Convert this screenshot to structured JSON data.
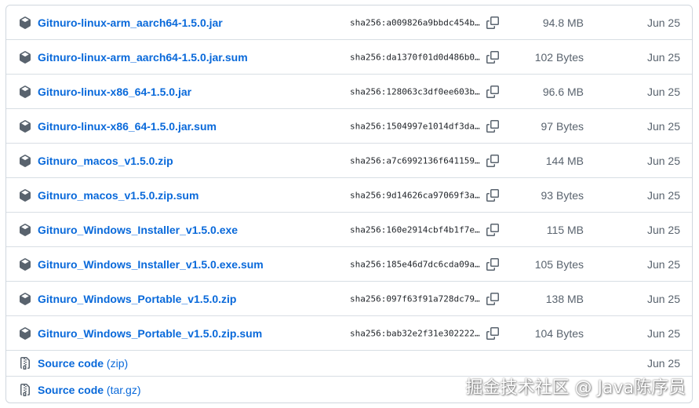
{
  "assets": [
    {
      "name": "Gitnuro-linux-arm_aarch64-1.5.0.jar",
      "sha": "sha256:a009826a9bbdc454b…",
      "size": "94.8 MB",
      "date": "Jun 25",
      "icon": "package-icon"
    },
    {
      "name": "Gitnuro-linux-arm_aarch64-1.5.0.jar.sum",
      "sha": "sha256:da1370f01d0d486b0…",
      "size": "102 Bytes",
      "date": "Jun 25",
      "icon": "package-icon"
    },
    {
      "name": "Gitnuro-linux-x86_64-1.5.0.jar",
      "sha": "sha256:128063c3df0ee603b…",
      "size": "96.6 MB",
      "date": "Jun 25",
      "icon": "package-icon"
    },
    {
      "name": "Gitnuro-linux-x86_64-1.5.0.jar.sum",
      "sha": "sha256:1504997e1014df3da…",
      "size": "97 Bytes",
      "date": "Jun 25",
      "icon": "package-icon"
    },
    {
      "name": "Gitnuro_macos_v1.5.0.zip",
      "sha": "sha256:a7c6992136f641159…",
      "size": "144 MB",
      "date": "Jun 25",
      "icon": "package-icon"
    },
    {
      "name": "Gitnuro_macos_v1.5.0.zip.sum",
      "sha": "sha256:9d14626ca97069f3a…",
      "size": "93 Bytes",
      "date": "Jun 25",
      "icon": "package-icon"
    },
    {
      "name": "Gitnuro_Windows_Installer_v1.5.0.exe",
      "sha": "sha256:160e2914cbf4b1f7e…",
      "size": "115 MB",
      "date": "Jun 25",
      "icon": "package-icon"
    },
    {
      "name": "Gitnuro_Windows_Installer_v1.5.0.exe.sum",
      "sha": "sha256:185e46d7dc6cda09a…",
      "size": "105 Bytes",
      "date": "Jun 25",
      "icon": "package-icon"
    },
    {
      "name": "Gitnuro_Windows_Portable_v1.5.0.zip",
      "sha": "sha256:097f63f91a728dc79…",
      "size": "138 MB",
      "date": "Jun 25",
      "icon": "package-icon"
    },
    {
      "name": "Gitnuro_Windows_Portable_v1.5.0.zip.sum",
      "sha": "sha256:bab32e2f31e302222…",
      "size": "104 Bytes",
      "date": "Jun 25",
      "icon": "package-icon"
    }
  ],
  "source": [
    {
      "name": "Source code",
      "ext": "(zip)",
      "date": "Jun 25",
      "icon": "file-zip-icon"
    },
    {
      "name": "Source code",
      "ext": "(tar.gz)",
      "date": "",
      "icon": "file-zip-icon"
    }
  ],
  "watermark": "掘金技术社区 @ Java陈序员",
  "colors": {
    "link": "#0969da",
    "muted": "#59636e",
    "border": "#d0d7de"
  }
}
